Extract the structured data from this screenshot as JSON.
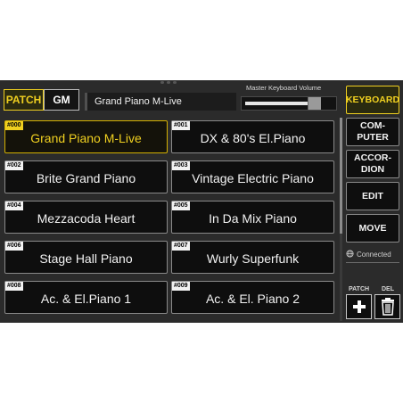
{
  "source_toggle": {
    "patch": "PATCH",
    "gm": "GM"
  },
  "selected_patch": "Grand Piano M-Live",
  "volume": {
    "label": "Master Keyboard Volume",
    "level": 0.8
  },
  "patches": [
    {
      "num": "#000",
      "name": "Grand Piano M-Live",
      "selected": true
    },
    {
      "num": "#001",
      "name": "DX & 80's El.Piano"
    },
    {
      "num": "#002",
      "name": "Brite Grand Piano"
    },
    {
      "num": "#003",
      "name": "Vintage Electric Piano"
    },
    {
      "num": "#004",
      "name": "Mezzacoda Heart"
    },
    {
      "num": "#005",
      "name": "In Da Mix Piano"
    },
    {
      "num": "#006",
      "name": "Stage Hall Piano"
    },
    {
      "num": "#007",
      "name": "Wurly Superfunk"
    },
    {
      "num": "#008",
      "name": "Ac. & El.Piano 1"
    },
    {
      "num": "#009",
      "name": "Ac. & El. Piano 2"
    }
  ],
  "side": {
    "keyboard": "KEYBOARD",
    "computer": [
      "COM-",
      "PUTER"
    ],
    "accordion": [
      "ACCOR-",
      "DION"
    ],
    "edit": "EDIT",
    "move": "MOVE",
    "status": "Connected",
    "patch_label": "PATCH",
    "del_label": "DEL"
  },
  "colors": {
    "accent": "#f0d020",
    "panel": "#2b2b2b",
    "tile": "#0e0e0e"
  },
  "icons": [
    "globe-icon",
    "plus-icon",
    "trash-icon"
  ]
}
